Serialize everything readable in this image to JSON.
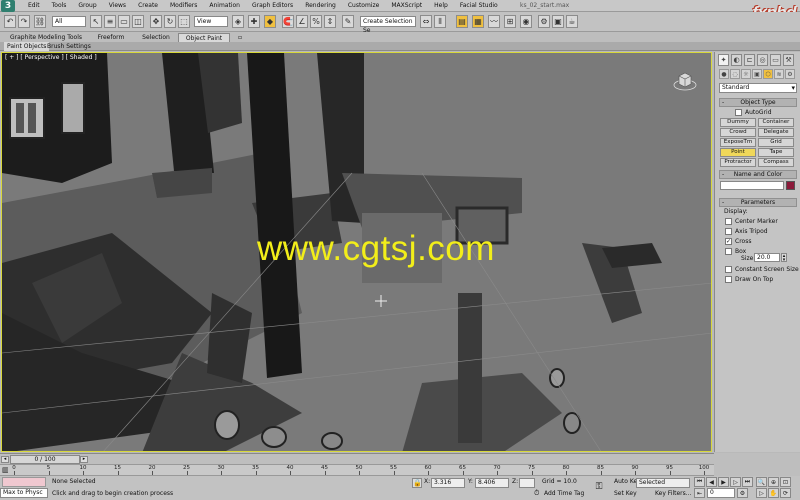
{
  "menu": {
    "app_icon": "3",
    "items": [
      "Edit",
      "Tools",
      "Group",
      "Views",
      "Create",
      "Modifiers",
      "Animation",
      "Graph Editors",
      "Rendering",
      "Customize",
      "MAXScript",
      "Help",
      "Facial Studio"
    ],
    "window_title": "ks_02_start.max",
    "brand_logo": "fxphd"
  },
  "toolbar": {
    "selection_filter": "All",
    "ref_coord": "View",
    "named_selection_placeholder": "Create Selection Se"
  },
  "ribbon": {
    "tabs": [
      "Graphite Modeling Tools",
      "Freeform",
      "Selection",
      "Object Paint"
    ],
    "active_tab": "Object Paint",
    "subtabs": [
      "Paint Objects",
      "Brush Settings"
    ]
  },
  "viewport": {
    "label": "[ + ] [ Perspective ] [ Shaded ]",
    "watermark": "www.cgtsj.com"
  },
  "command_panel": {
    "dropdown": "Standard",
    "object_type_title": "Object Type",
    "autogrid_label": "AutoGrid",
    "object_buttons": [
      "Dummy",
      "Container",
      "Crowd",
      "Delegate",
      "ExposeTm",
      "Grid",
      "Point",
      "Tape",
      "Protractor",
      "Compass"
    ],
    "active_object": "Point",
    "name_color_title": "Name and Color",
    "name_value": "",
    "object_color": "#8b1a3a",
    "parameters_title": "Parameters",
    "display_label": "Display:",
    "checkboxes": [
      {
        "label": "Center Marker",
        "checked": false
      },
      {
        "label": "Axis Tripod",
        "checked": false
      },
      {
        "label": "Cross",
        "checked": true
      },
      {
        "label": "Box",
        "checked": false
      }
    ],
    "size_label": "Size:",
    "size_value": "20.0",
    "constant_screen_size": "Constant Screen Size",
    "draw_on_top": "Draw On Top"
  },
  "timeline": {
    "slider_text": "0 / 100",
    "ticks": [
      "0",
      "5",
      "10",
      "15",
      "20",
      "25",
      "30",
      "35",
      "40",
      "45",
      "50",
      "55",
      "60",
      "65",
      "70",
      "75",
      "80",
      "85",
      "90",
      "95",
      "100"
    ]
  },
  "status": {
    "maxscript_listener": "Max to Physc",
    "selection_info": "None Selected",
    "prompt": "Click and drag to begin creation process",
    "x_label": "X:",
    "x_value": "3.316",
    "y_label": "Y:",
    "y_value": "8.406",
    "z_label": "Z:",
    "z_value": "",
    "grid": "Grid = 10.0",
    "add_time_tag": "Add Time Tag",
    "auto_key": "Auto Key",
    "set_key": "Set Key",
    "key_mode": "Selected",
    "key_filters": "Key Filters...",
    "frame": "0"
  },
  "colors": {
    "viewport_border": "#d8d83a",
    "watermark": "#f2ee1a",
    "active_button": "#f0d85a"
  }
}
